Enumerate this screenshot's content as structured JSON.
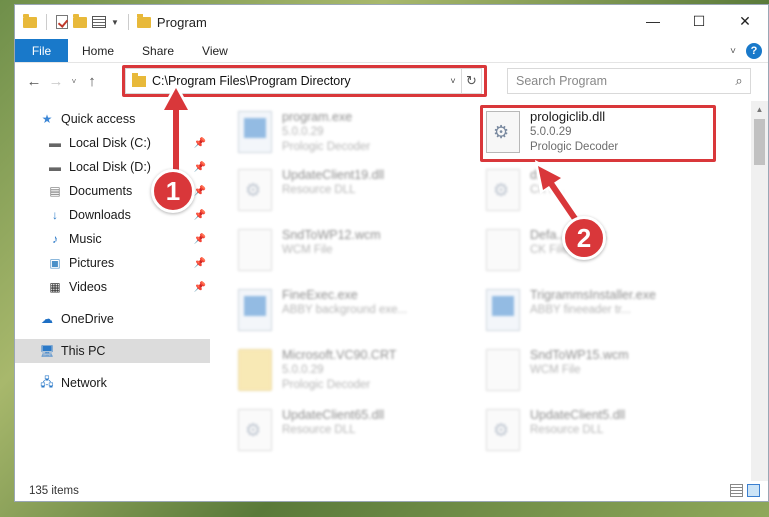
{
  "window": {
    "title": "Program"
  },
  "ribbon": {
    "tabs": [
      "File",
      "Home",
      "Share",
      "View"
    ],
    "help": "?"
  },
  "navigation": {
    "address": "C:\\Program Files\\Program Directory",
    "search_placeholder": "Search Program"
  },
  "sidebar": {
    "items": [
      {
        "label": "Quick access",
        "icon": "star-icon"
      },
      {
        "label": "Local Disk (C:)",
        "icon": "drive-icon"
      },
      {
        "label": "Local Disk (D:)",
        "icon": "drive-icon"
      },
      {
        "label": "Documents",
        "icon": "documents-icon"
      },
      {
        "label": "Downloads",
        "icon": "download-icon"
      },
      {
        "label": "Music",
        "icon": "music-icon"
      },
      {
        "label": "Pictures",
        "icon": "pictures-icon"
      },
      {
        "label": "Videos",
        "icon": "videos-icon"
      },
      {
        "label": "OneDrive",
        "icon": "cloud-icon"
      },
      {
        "label": "This PC",
        "icon": "computer-icon"
      },
      {
        "label": "Network",
        "icon": "network-icon"
      }
    ]
  },
  "files": [
    {
      "name": "program.exe",
      "line1": "5.0.0.29",
      "line2": "Prologic Decoder",
      "icon": "exe"
    },
    {
      "name": "prologiclib.dll",
      "line1": "5.0.0.29",
      "line2": "Prologic Decoder",
      "icon": "gear"
    },
    {
      "name": "UpdateClient19.dll",
      "line1": "Resource DLL",
      "icon": "gear"
    },
    {
      "name": "d...",
      "line1": "CK F...",
      "icon": "gear"
    },
    {
      "name": "SndToWP12.wcm",
      "line1": "WCM File",
      "icon": "doc"
    },
    {
      "name": "Defa..........cjk",
      "line1": "CK File",
      "icon": "doc"
    },
    {
      "name": "FineExec.exe",
      "line1": "ABBY background exe...",
      "icon": "exe"
    },
    {
      "name": "TrigrammsInstaller.exe",
      "line1": "ABBY fineeader tr...",
      "icon": "exe"
    },
    {
      "name": "Microsoft.VC90.CRT",
      "line1": "5.0.0.29",
      "line2": "Prologic Decoder",
      "icon": "folder"
    },
    {
      "name": "SndToWP15.wcm",
      "line1": "WCM File",
      "icon": "doc"
    },
    {
      "name": "UpdateClient65.dll",
      "line1": "Resource DLL",
      "icon": "gear"
    },
    {
      "name": "UpdateClient5.dll",
      "line1": "Resource DLL",
      "icon": "gear"
    }
  ],
  "status": {
    "item_count": "135 items"
  },
  "annotations": {
    "step1": "1",
    "step2": "2",
    "color": "#d9373a"
  }
}
